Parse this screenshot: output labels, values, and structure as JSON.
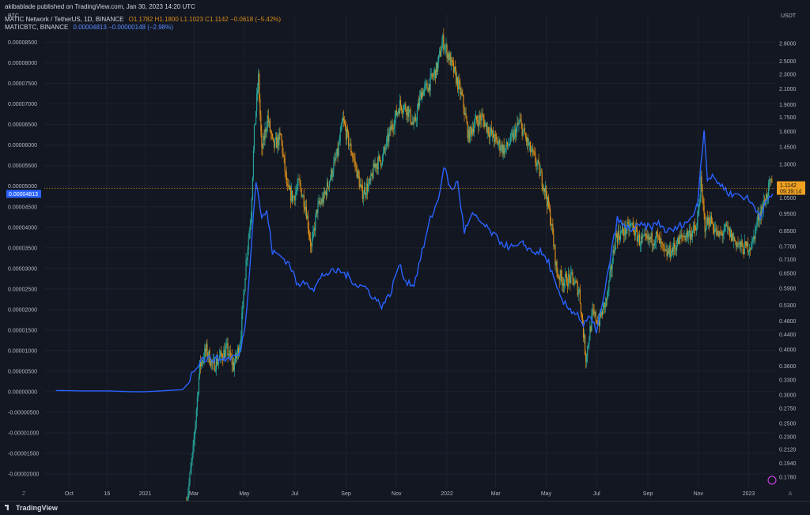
{
  "header": {
    "published": "akibablade published on TradingView.com, Jan 30, 2023 14:20 UTC",
    "main_symbol": "MATIC Network / TetherUS, 1D, BINANCE",
    "ohlc": "O1.1782 H1.1800 L1.1023 C1.1142 −0.0618 (−5.42%)",
    "overlay_symbol": "MATICBTC, BINANCE",
    "overlay_values": "0.00004813 −0.00000148 (−2.98%)"
  },
  "colors": {
    "background": "#131722",
    "grid": "#1e222d",
    "up": "#26a69a",
    "down": "#d98c1a",
    "overlay_line": "#2962ff",
    "price_line": "#d98c1a",
    "text": "#d1d4dc",
    "axis_text": "#b2b5be"
  },
  "footer": {
    "brand": "TradingView"
  },
  "chart_data": {
    "type": "line",
    "left_axis": {
      "title": "BTC",
      "ticks": [
        "0.00008500",
        "0.00008000",
        "0.00007500",
        "0.00007000",
        "0.00006500",
        "0.00006000",
        "0.00005500",
        "0.00005000",
        "0.00004500",
        "0.00004000",
        "0.00003500",
        "0.00003000",
        "0.00002500",
        "0.00002000",
        "0.00001500",
        "0.00001000",
        "0.00000500",
        "0.00000000",
        "-0.00000500",
        "-0.00001000",
        "-0.00001500",
        "-0.00002000"
      ],
      "range": [
        -2.25e-05,
        8.8e-05
      ],
      "current_label": "0.00004813"
    },
    "right_axis": {
      "title": "USDT",
      "scale": "log",
      "ticks": [
        "2.8000",
        "2.5000",
        "2.3000",
        "2.1000",
        "1.9000",
        "1.7500",
        "1.6000",
        "1.4500",
        "1.3000",
        "1.1500",
        "1.0500",
        "0.9500",
        "0.8500",
        "0.7700",
        "0.7100",
        "0.6500",
        "0.5900",
        "0.5300",
        "0.4800",
        "0.4400",
        "0.4000",
        "0.3600",
        "0.3300",
        "0.3000",
        "0.2750",
        "0.2500",
        "0.2300",
        "0.2120",
        "0.1940",
        "0.1780"
      ],
      "range": [
        0.17,
        3.05
      ],
      "current_label": "1.1142",
      "countdown": "09:39:14"
    },
    "x_axis": {
      "ticks": [
        "Oct",
        "16",
        "2021",
        "Mar",
        "May",
        "Jul",
        "Sep",
        "Nov",
        "2022",
        "Mar",
        "May",
        "Jul",
        "Sep",
        "Nov",
        "2023"
      ],
      "tick_dates": [
        "2020-10-01",
        "2020-11-16",
        "2021-01-01",
        "2021-03-01",
        "2021-05-01",
        "2021-07-01",
        "2021-09-01",
        "2021-11-01",
        "2022-01-01",
        "2022-03-01",
        "2022-05-01",
        "2022-07-01",
        "2022-09-01",
        "2022-11-01",
        "2023-01-01"
      ],
      "range": [
        "2020-09-01",
        "2023-02-02"
      ]
    },
    "series": [
      {
        "name": "MATIC Network / TetherUS",
        "axis": "right",
        "style": "candles",
        "points": [
          [
            "2021-02-20",
            0.15
          ],
          [
            "2021-02-28",
            0.21
          ],
          [
            "2021-03-08",
            0.36
          ],
          [
            "2021-03-16",
            0.4
          ],
          [
            "2021-03-24",
            0.36
          ],
          [
            "2021-04-01",
            0.38
          ],
          [
            "2021-04-10",
            0.4
          ],
          [
            "2021-04-18",
            0.36
          ],
          [
            "2021-04-26",
            0.42
          ],
          [
            "2021-05-03",
            0.7
          ],
          [
            "2021-05-09",
            0.95
          ],
          [
            "2021-05-13",
            1.6
          ],
          [
            "2021-05-18",
            2.25
          ],
          [
            "2021-05-22",
            1.4
          ],
          [
            "2021-05-29",
            1.75
          ],
          [
            "2021-06-05",
            1.45
          ],
          [
            "2021-06-14",
            1.55
          ],
          [
            "2021-06-22",
            1.1
          ],
          [
            "2021-06-29",
            1.05
          ],
          [
            "2021-07-06",
            1.15
          ],
          [
            "2021-07-14",
            1.0
          ],
          [
            "2021-07-21",
            0.76
          ],
          [
            "2021-07-28",
            0.98
          ],
          [
            "2021-08-05",
            1.05
          ],
          [
            "2021-08-14",
            1.22
          ],
          [
            "2021-08-22",
            1.4
          ],
          [
            "2021-08-28",
            1.72
          ],
          [
            "2021-09-04",
            1.5
          ],
          [
            "2021-09-12",
            1.3
          ],
          [
            "2021-09-20",
            1.08
          ],
          [
            "2021-09-30",
            1.15
          ],
          [
            "2021-10-06",
            1.3
          ],
          [
            "2021-10-15",
            1.35
          ],
          [
            "2021-10-25",
            1.62
          ],
          [
            "2021-11-05",
            1.9
          ],
          [
            "2021-11-14",
            1.85
          ],
          [
            "2021-11-22",
            1.65
          ],
          [
            "2021-12-01",
            2.05
          ],
          [
            "2021-12-10",
            2.15
          ],
          [
            "2021-12-20",
            2.4
          ],
          [
            "2021-12-27",
            2.85
          ],
          [
            "2022-01-04",
            2.55
          ],
          [
            "2022-01-12",
            2.25
          ],
          [
            "2022-01-20",
            1.95
          ],
          [
            "2022-01-27",
            1.55
          ],
          [
            "2022-02-04",
            1.7
          ],
          [
            "2022-02-12",
            1.75
          ],
          [
            "2022-02-20",
            1.62
          ],
          [
            "2022-03-02",
            1.5
          ],
          [
            "2022-03-12",
            1.42
          ],
          [
            "2022-03-22",
            1.55
          ],
          [
            "2022-03-30",
            1.7
          ],
          [
            "2022-04-10",
            1.45
          ],
          [
            "2022-04-20",
            1.3
          ],
          [
            "2022-04-30",
            1.1
          ],
          [
            "2022-05-07",
            0.9
          ],
          [
            "2022-05-14",
            0.65
          ],
          [
            "2022-05-22",
            0.62
          ],
          [
            "2022-06-01",
            0.63
          ],
          [
            "2022-06-10",
            0.58
          ],
          [
            "2022-06-18",
            0.38
          ],
          [
            "2022-06-26",
            0.5
          ],
          [
            "2022-07-04",
            0.48
          ],
          [
            "2022-07-14",
            0.56
          ],
          [
            "2022-07-24",
            0.82
          ],
          [
            "2022-08-03",
            0.85
          ],
          [
            "2022-08-13",
            0.88
          ],
          [
            "2022-08-22",
            0.8
          ],
          [
            "2022-09-01",
            0.8
          ],
          [
            "2022-09-12",
            0.82
          ],
          [
            "2022-09-22",
            0.73
          ],
          [
            "2022-10-02",
            0.76
          ],
          [
            "2022-10-12",
            0.82
          ],
          [
            "2022-10-22",
            0.84
          ],
          [
            "2022-10-30",
            0.86
          ],
          [
            "2022-11-04",
            1.15
          ],
          [
            "2022-11-09",
            0.88
          ],
          [
            "2022-11-15",
            0.92
          ],
          [
            "2022-11-25",
            0.82
          ],
          [
            "2022-12-05",
            0.86
          ],
          [
            "2022-12-15",
            0.8
          ],
          [
            "2022-12-25",
            0.76
          ],
          [
            "2023-01-05",
            0.78
          ],
          [
            "2023-01-12",
            0.92
          ],
          [
            "2023-01-20",
            1.02
          ],
          [
            "2023-01-27",
            1.15
          ],
          [
            "2023-01-30",
            1.1142
          ]
        ]
      },
      {
        "name": "MATICBTC, BINANCE",
        "axis": "left",
        "style": "line",
        "points": [
          [
            "2020-09-15",
            3e-07
          ],
          [
            "2020-10-15",
            2e-07
          ],
          [
            "2020-11-15",
            2e-07
          ],
          [
            "2020-12-15",
            0.0
          ],
          [
            "2021-01-01",
            0.0
          ],
          [
            "2021-01-20",
            2e-07
          ],
          [
            "2021-02-15",
            5e-07
          ],
          [
            "2021-02-20",
            1.5e-06
          ],
          [
            "2021-02-28",
            5e-06
          ],
          [
            "2021-03-10",
            8e-06
          ],
          [
            "2021-03-25",
            8e-06
          ],
          [
            "2021-04-10",
            8e-06
          ],
          [
            "2021-04-25",
            9e-06
          ],
          [
            "2021-04-30",
            1.4e-05
          ],
          [
            "2021-05-04",
            2e-05
          ],
          [
            "2021-05-08",
            3.2e-05
          ],
          [
            "2021-05-12",
            4.4e-05
          ],
          [
            "2021-05-15",
            5.1e-05
          ],
          [
            "2021-05-18",
            4.8e-05
          ],
          [
            "2021-05-22",
            4.2e-05
          ],
          [
            "2021-05-28",
            4.4e-05
          ],
          [
            "2021-06-04",
            3.4e-05
          ],
          [
            "2021-06-14",
            3.3e-05
          ],
          [
            "2021-06-25",
            3.1e-05
          ],
          [
            "2021-07-05",
            2.55e-05
          ],
          [
            "2021-07-14",
            2.7e-05
          ],
          [
            "2021-07-24",
            2.5e-05
          ],
          [
            "2021-08-04",
            2.85e-05
          ],
          [
            "2021-08-14",
            2.9e-05
          ],
          [
            "2021-08-24",
            2.95e-05
          ],
          [
            "2021-09-04",
            2.8e-05
          ],
          [
            "2021-09-14",
            2.6e-05
          ],
          [
            "2021-09-24",
            2.55e-05
          ],
          [
            "2021-10-04",
            2.3e-05
          ],
          [
            "2021-10-14",
            2.1e-05
          ],
          [
            "2021-10-24",
            2.35e-05
          ],
          [
            "2021-11-04",
            3.1e-05
          ],
          [
            "2021-11-12",
            2.7e-05
          ],
          [
            "2021-11-22",
            2.6e-05
          ],
          [
            "2021-12-02",
            3.4e-05
          ],
          [
            "2021-12-12",
            4.2e-05
          ],
          [
            "2021-12-22",
            4.7e-05
          ],
          [
            "2021-12-28",
            5.5e-05
          ],
          [
            "2022-01-06",
            4.9e-05
          ],
          [
            "2022-01-14",
            5.1e-05
          ],
          [
            "2022-01-22",
            3.9e-05
          ],
          [
            "2022-02-01",
            4.3e-05
          ],
          [
            "2022-02-12",
            4.1e-05
          ],
          [
            "2022-02-22",
            3.9e-05
          ],
          [
            "2022-03-04",
            3.7e-05
          ],
          [
            "2022-03-14",
            3.55e-05
          ],
          [
            "2022-03-24",
            3.5e-05
          ],
          [
            "2022-04-04",
            3.6e-05
          ],
          [
            "2022-04-14",
            3.4e-05
          ],
          [
            "2022-04-24",
            3.4e-05
          ],
          [
            "2022-05-04",
            3.15e-05
          ],
          [
            "2022-05-12",
            2.6e-05
          ],
          [
            "2022-05-20",
            2.2e-05
          ],
          [
            "2022-05-30",
            2e-05
          ],
          [
            "2022-06-08",
            1.9e-05
          ],
          [
            "2022-06-15",
            1.6e-05
          ],
          [
            "2022-06-22",
            1.8e-05
          ],
          [
            "2022-07-01",
            1.5e-05
          ],
          [
            "2022-07-09",
            2.2e-05
          ],
          [
            "2022-07-18",
            3.3e-05
          ],
          [
            "2022-07-26",
            4.2e-05
          ],
          [
            "2022-08-04",
            4e-05
          ],
          [
            "2022-08-14",
            3.95e-05
          ],
          [
            "2022-08-24",
            4.05e-05
          ],
          [
            "2022-09-04",
            4e-05
          ],
          [
            "2022-09-14",
            4.1e-05
          ],
          [
            "2022-09-24",
            3.9e-05
          ],
          [
            "2022-10-04",
            3.95e-05
          ],
          [
            "2022-10-14",
            4.1e-05
          ],
          [
            "2022-10-24",
            4.2e-05
          ],
          [
            "2022-10-31",
            4.6e-05
          ],
          [
            "2022-11-04",
            5.5e-05
          ],
          [
            "2022-11-08",
            6.4e-05
          ],
          [
            "2022-11-12",
            5.2e-05
          ],
          [
            "2022-11-20",
            5.2e-05
          ],
          [
            "2022-11-30",
            5e-05
          ],
          [
            "2022-12-10",
            4.8e-05
          ],
          [
            "2022-12-20",
            4.8e-05
          ],
          [
            "2022-12-30",
            4.7e-05
          ],
          [
            "2023-01-08",
            4.5e-05
          ],
          [
            "2023-01-15",
            4.3e-05
          ],
          [
            "2023-01-22",
            4.6e-05
          ],
          [
            "2023-01-30",
            4.813e-05
          ]
        ]
      }
    ]
  }
}
